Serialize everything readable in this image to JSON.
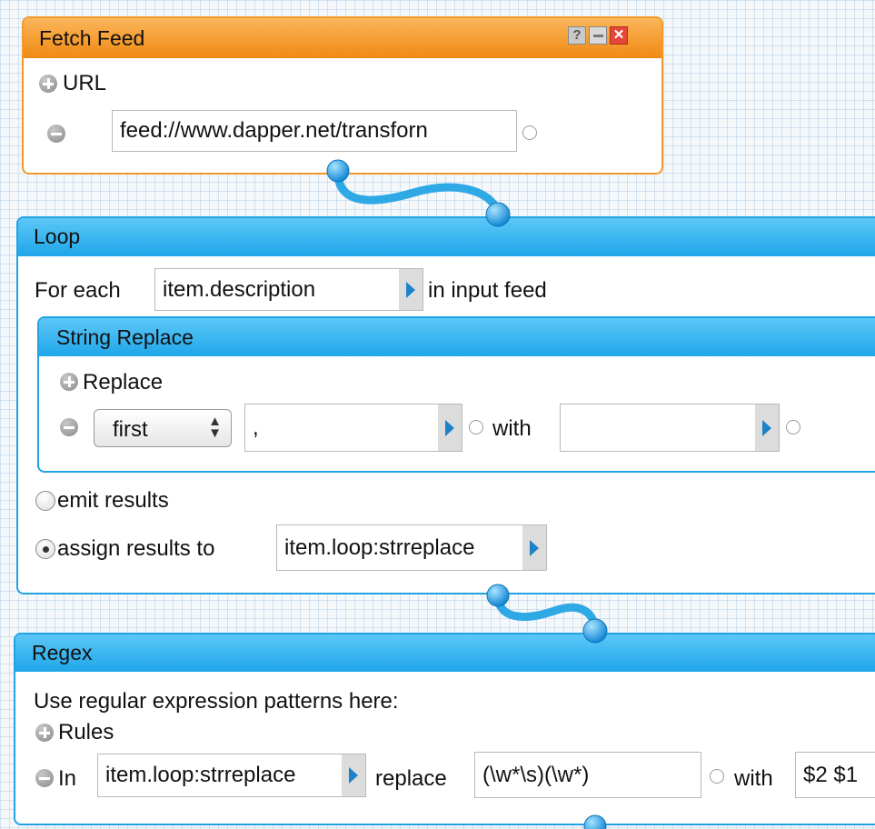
{
  "fetch_feed": {
    "title": "Fetch Feed",
    "help_label": "?",
    "url_label": "URL",
    "url_value": "feed://www.dapper.net/transforn"
  },
  "loop": {
    "title": "Loop",
    "for_each_label": "For each",
    "for_each_value": "item.description",
    "in_input_feed_label": "in input feed",
    "string_replace": {
      "title": "String Replace",
      "replace_label": "Replace",
      "mode_value": "first",
      "search_value": ",",
      "with_label": "with",
      "replacement_value": ""
    },
    "emit_results_label": "emit results",
    "assign_results_label": "assign results to",
    "assign_results_value": "item.loop:strreplace"
  },
  "regex": {
    "title": "Regex",
    "description": "Use regular expression patterns here:",
    "rules_label": "Rules",
    "in_label": "In",
    "in_value": "item.loop:strreplace",
    "replace_label": "replace",
    "pattern_value": "(\\w*\\s)(\\w*)",
    "with_label": "with",
    "replacement_value": "$2 $1"
  },
  "colors": {
    "fetch_header": "#f08a12",
    "loop_header": "#1fa6ea",
    "pipe_wire": "#2fa8e6"
  }
}
